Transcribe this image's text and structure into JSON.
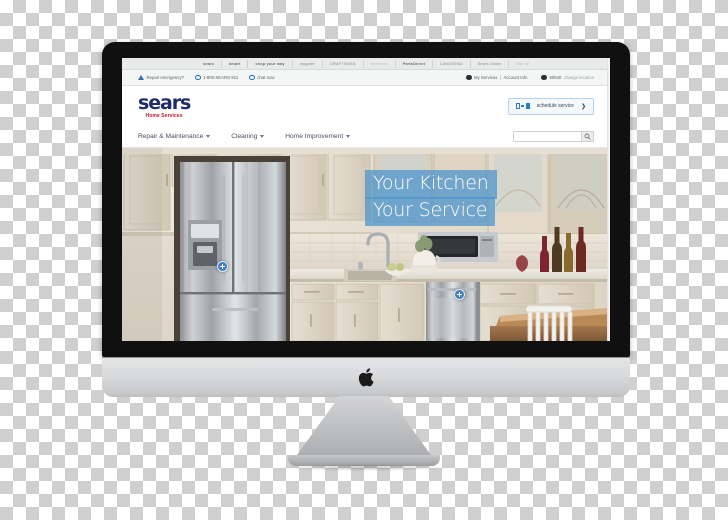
{
  "device": {
    "type": "imac-desktop-monitor",
    "brand_logo": "apple-logo"
  },
  "site": {
    "partner_bar": [
      {
        "label": "sears",
        "style": "b"
      },
      {
        "label": "kmart",
        "style": "b"
      },
      {
        "label": "shop your way",
        "style": "b"
      },
      {
        "label": "mygofer",
        "style": "normal"
      },
      {
        "label": "CRAFTSMAN",
        "style": "normal"
      },
      {
        "label": "Kenmore",
        "style": "dim"
      },
      {
        "label": "PartsDirect",
        "style": "b"
      },
      {
        "label": "LANDSEND",
        "style": "normal"
      },
      {
        "label": "Sears Outlet",
        "style": "normal"
      },
      {
        "label": "See all",
        "style": "dim"
      }
    ],
    "utility_bar": {
      "repair_emergency": "Repair emergency?",
      "phone": "1-800-SEARS-911",
      "chat": "chat now",
      "my_services": "My Services",
      "separator": "|",
      "account_info": "Account Info",
      "zip": "60640",
      "change_location": "change location"
    },
    "logo": {
      "name": "sears",
      "tagline": "Home Services"
    },
    "schedule_button": {
      "label": "schedule service",
      "chevron": "❯"
    },
    "nav": [
      {
        "label": "Repair & Maintenance",
        "has_dropdown": true
      },
      {
        "label": "Cleaning",
        "has_dropdown": true
      },
      {
        "label": "Home Improvement",
        "has_dropdown": true
      }
    ],
    "search": {
      "value": "",
      "placeholder": "",
      "icon": "search-icon"
    },
    "hero": {
      "headline_line1": "Your Kitchen",
      "headline_line2": "Your Service",
      "scene": "modern kitchen with stainless steel french-door refrigerator, cream cabinets, marble backsplash, sink, microwave and wine bottles",
      "band_color": "#4a93cd",
      "hotspots": [
        {
          "name": "refrigerator-hotspot",
          "glyph": "+"
        },
        {
          "name": "dishwasher-hotspot",
          "glyph": "+"
        }
      ]
    }
  },
  "colors": {
    "brand_navy": "#1d2d6b",
    "brand_red": "#c8102e",
    "accent_blue": "#2f7bc4",
    "hero_band": "#4a93cd",
    "bezel": "#111010",
    "chin": "#d9dadb"
  }
}
